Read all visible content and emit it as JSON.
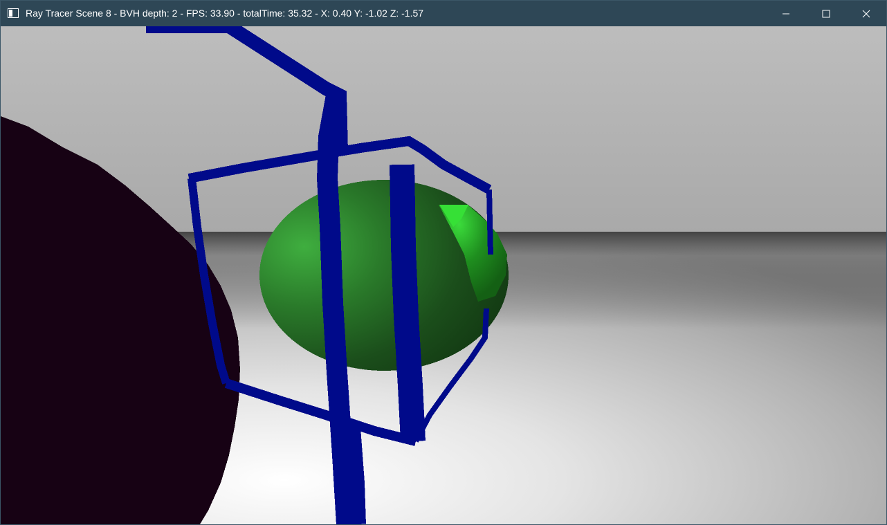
{
  "window": {
    "title": "Ray Tracer Scene 8 - BVH depth: 2 - FPS: 33.90 - totalTime: 35.32 - X: 0.40 Y: -1.02 Z: -1.57",
    "icon": "app-window-icon",
    "controls": {
      "minimize": "minimize-icon",
      "maximize": "maximize-icon",
      "close": "close-icon"
    }
  },
  "scene": {
    "wall_color": "#b4b4b4",
    "floor_color": "#c8c8c8",
    "dark_sphere_color": "#170214",
    "green_sphere_color": "#2f8a2f",
    "small_green_sphere_color": "#33cc33",
    "bvh_box_color": "#000a8a"
  }
}
